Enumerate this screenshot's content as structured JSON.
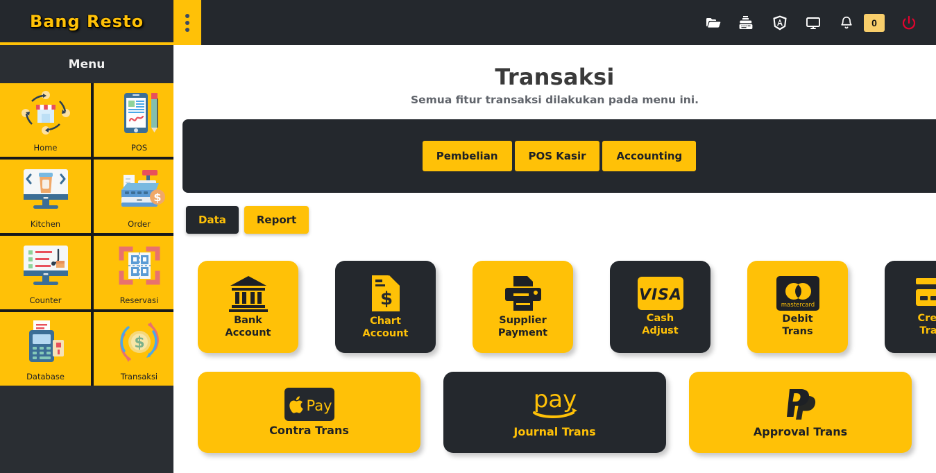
{
  "topbar": {
    "brand": "Bang Resto",
    "menu_toggle_icon": "kebab-menu-icon",
    "icons": [
      {
        "name": "folder-open-icon",
        "label": "Folder"
      },
      {
        "name": "cash-register-icon",
        "label": "Cash Register"
      },
      {
        "name": "angular-icon",
        "label": "Angular"
      },
      {
        "name": "desktop-icon",
        "label": "Desktop"
      },
      {
        "name": "bell-icon",
        "label": "Notifications"
      }
    ],
    "notification_count": "0",
    "power_icon": "power-icon",
    "accent": "#FFC107",
    "dark": "#24282d",
    "power_color": "#e3032e"
  },
  "sidebar": {
    "title": "Menu",
    "items": [
      {
        "label": "Home",
        "icon": "store-cycle-icon"
      },
      {
        "label": "POS",
        "icon": "mobile-signature-pen-icon"
      },
      {
        "label": "Kitchen",
        "icon": "monitor-coffee-icon"
      },
      {
        "label": "Order",
        "icon": "cash-register-dollar-icon"
      },
      {
        "label": "Counter",
        "icon": "monitor-checklist-icon"
      },
      {
        "label": "Reservasi",
        "icon": "qr-scan-icon"
      },
      {
        "label": "Database",
        "icon": "card-terminal-receipt-icon"
      },
      {
        "label": "Transaksi",
        "icon": "dollar-cycle-icon"
      }
    ]
  },
  "main": {
    "title": "Transaksi",
    "subtitle": "Semua fitur transaksi dilakukan pada menu ini.",
    "segments": [
      {
        "label": "Pembelian"
      },
      {
        "label": "POS Kasir"
      },
      {
        "label": "Accounting"
      }
    ],
    "tabs": [
      {
        "label": "Data",
        "active": true
      },
      {
        "label": "Report",
        "active": false
      }
    ],
    "cards_row1": [
      {
        "label": "Bank\nAccount",
        "line1": "Bank",
        "line2": "Account",
        "icon": "bank-icon",
        "theme": "yellow"
      },
      {
        "label": "Chart Account",
        "line1": "Chart",
        "line2": "Account",
        "icon": "file-invoice-dollar-icon",
        "theme": "dark"
      },
      {
        "label": "Supplier Payment",
        "line1": "Supplier",
        "line2": "Payment",
        "icon": "printer-icon",
        "theme": "yellow"
      },
      {
        "label": "Cash Adjust",
        "line1": "Cash",
        "line2": "Adjust",
        "icon": "visa-icon",
        "theme": "dark"
      },
      {
        "label": "Debit Trans",
        "line1": "Debit",
        "line2": "Trans",
        "icon": "mastercard-icon",
        "theme": "yellow"
      },
      {
        "label": "Credit Trans",
        "line1": "Credit",
        "line2": "Trans",
        "icon": "credit-card-icon",
        "theme": "dark"
      }
    ],
    "cards_row2": [
      {
        "label": "Contra Trans",
        "icon": "apple-pay-icon",
        "theme": "yellow"
      },
      {
        "label": "Journal Trans",
        "icon": "amazon-pay-icon",
        "theme": "dark"
      },
      {
        "label": "Approval Trans",
        "icon": "paypal-icon",
        "theme": "yellow"
      }
    ]
  }
}
